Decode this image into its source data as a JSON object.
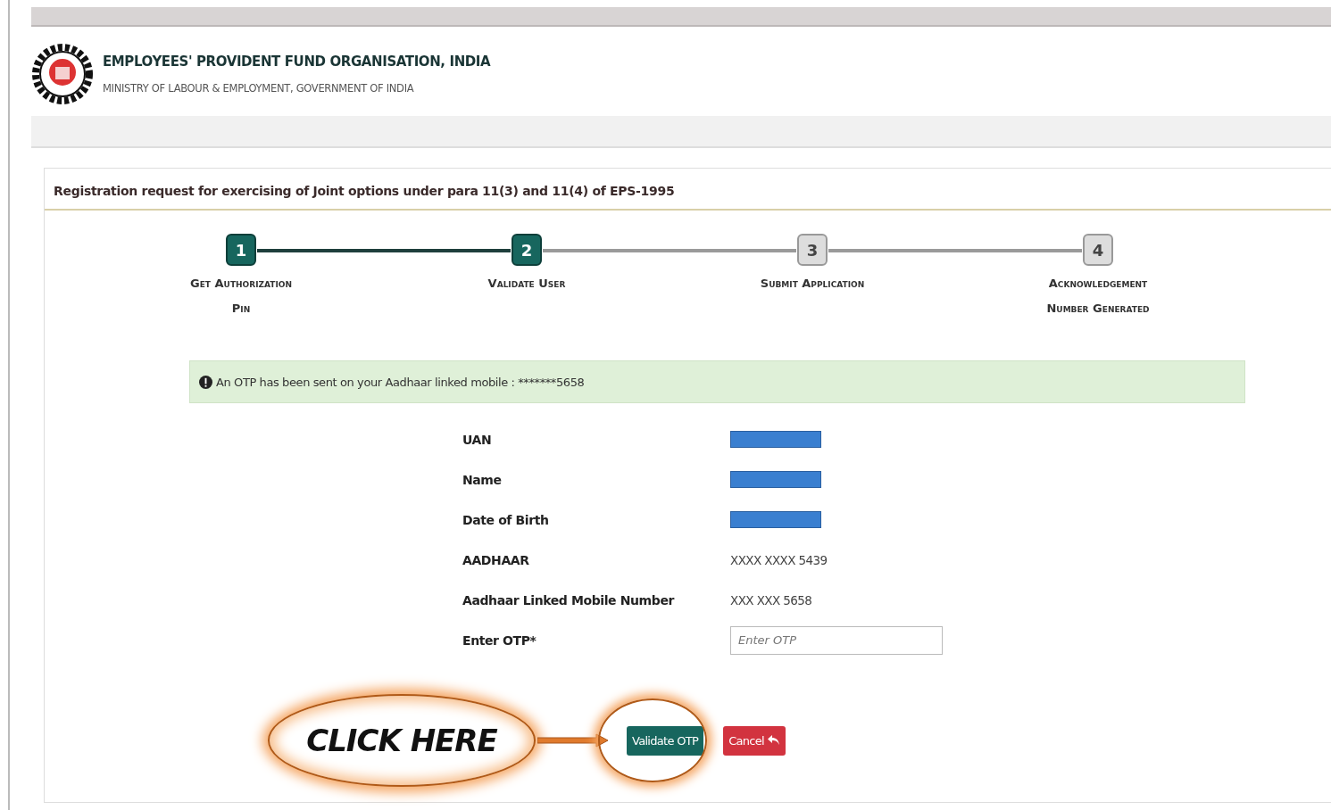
{
  "header": {
    "title": "EMPLOYEES' PROVIDENT FUND ORGANISATION, INDIA",
    "subtitle": "MINISTRY OF LABOUR & EMPLOYMENT, GOVERNMENT OF INDIA"
  },
  "panel": {
    "title": "Registration request for exercising of Joint options under para 11(3) and 11(4) of EPS-1995"
  },
  "steps": [
    {
      "number": "1",
      "lines": [
        "Get Authorization",
        "Pin"
      ],
      "completed": true
    },
    {
      "number": "2",
      "lines": [
        "Validate User"
      ],
      "completed": true
    },
    {
      "number": "3",
      "lines": [
        "Submit Application"
      ],
      "completed": false
    },
    {
      "number": "4",
      "lines": [
        "Acknowledgement",
        "Number Generated"
      ],
      "completed": false
    }
  ],
  "alert": {
    "message": "An OTP has been sent on your Aadhaar linked mobile : *******5658"
  },
  "fields": [
    {
      "kind": "redacted",
      "label": "UAN"
    },
    {
      "kind": "redacted",
      "label": "Name"
    },
    {
      "kind": "redacted",
      "label": "Date of Birth"
    },
    {
      "kind": "text",
      "label": "AADHAAR",
      "value": "XXXX XXXX 5439"
    },
    {
      "kind": "text",
      "label": "Aadhaar Linked Mobile Number",
      "value": "XXX XXX 5658"
    },
    {
      "kind": "input",
      "label": "Enter OTP*",
      "placeholder": "Enter OTP"
    }
  ],
  "buttons": [
    {
      "kind": "primary",
      "label": "Validate OTP"
    },
    {
      "kind": "danger",
      "label": "Cancel"
    }
  ],
  "callout": {
    "text": "CLICK HERE"
  }
}
